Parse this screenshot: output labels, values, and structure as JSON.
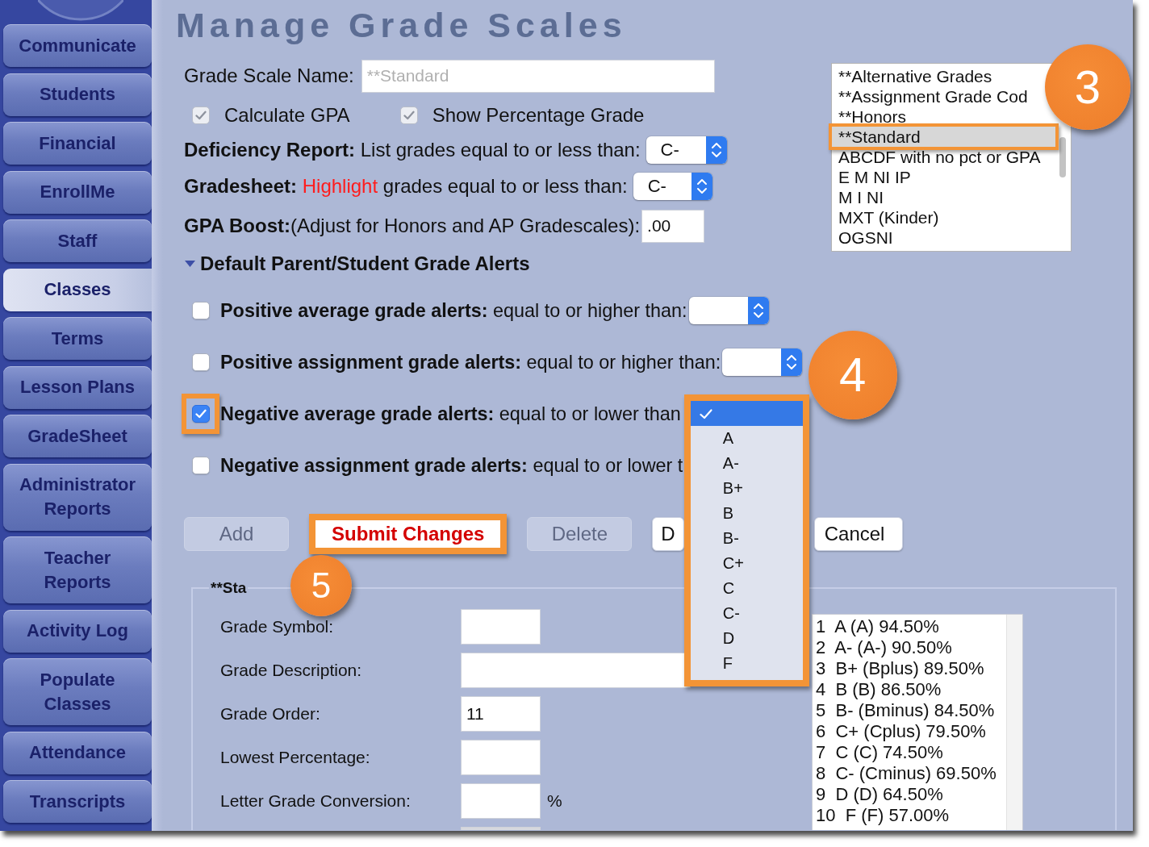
{
  "sidebar": {
    "items": [
      {
        "label": "Communicate",
        "selected": false
      },
      {
        "label": "Students",
        "selected": false
      },
      {
        "label": "Financial",
        "selected": false
      },
      {
        "label": "EnrollMe",
        "selected": false
      },
      {
        "label": "Staff",
        "selected": false
      },
      {
        "label": "Classes",
        "selected": true
      },
      {
        "label": "Terms",
        "selected": false
      },
      {
        "label": "Lesson Plans",
        "selected": false
      },
      {
        "label": "GradeSheet",
        "selected": false
      },
      {
        "label": "Administrator Reports",
        "selected": false
      },
      {
        "label": "Teacher Reports",
        "selected": false
      },
      {
        "label": "Activity Log",
        "selected": false
      },
      {
        "label": "Populate Classes",
        "selected": false
      },
      {
        "label": "Attendance",
        "selected": false
      },
      {
        "label": "Transcripts",
        "selected": false
      }
    ]
  },
  "page": {
    "title": "Manage Grade Scales"
  },
  "scale_form": {
    "name_field": {
      "label": "Grade Scale Name:",
      "placeholder": "**Standard"
    },
    "options": [
      {
        "label": "Calculate GPA",
        "checked": true,
        "disabled": true
      },
      {
        "label": "Show Percentage Grade",
        "checked": true,
        "disabled": true
      }
    ],
    "deficiency_report": {
      "text": "**Deficiency Report:** List grades equal to or less than:",
      "value": "C-"
    },
    "gradesheet": {
      "parts": [
        {
          "kind": "bold",
          "text": "Gradesheet:"
        },
        {
          "kind": "accent",
          "text": "Highlight"
        },
        {
          "kind": "plain",
          "text": "grades equal to or less than:"
        }
      ],
      "value": "C-"
    },
    "gpa_boost": {
      "text": "**GPA Boost:**(Adjust for Honors and AP Gradescales):",
      "value": ".00"
    }
  },
  "scale_list": {
    "items": [
      {
        "label": "**Alternative Grades",
        "selected": false,
        "highlighted": false
      },
      {
        "label": "**Assignment Grade Cod",
        "selected": false,
        "highlighted": false
      },
      {
        "label": "**Honors",
        "selected": false,
        "highlighted": false
      },
      {
        "label": "**Standard",
        "selected": true,
        "highlighted": true,
        "callout": "3"
      },
      {
        "label": "ABCDF with no pct or GPA",
        "selected": false,
        "highlighted": false
      },
      {
        "label": "E M NI IP",
        "selected": false,
        "highlighted": false
      },
      {
        "label": "M I NI",
        "selected": false,
        "highlighted": false
      },
      {
        "label": "MXT (Kinder)",
        "selected": false,
        "highlighted": false
      },
      {
        "label": "OGSNI",
        "selected": false,
        "highlighted": false
      }
    ]
  },
  "alerts": {
    "title": "Default Parent/Student Grade Alerts",
    "expanded": true,
    "rows": [
      {
        "text": "**Positive average grade alerts:** equal to or higher than:",
        "checked": false,
        "highlighted": false,
        "select": {
          "open": false
        }
      },
      {
        "text": "**Positive assignment grade alerts:** equal to or higher than:",
        "checked": false,
        "highlighted": false,
        "select": {
          "open": false
        }
      },
      {
        "text": "**Negative average grade alerts:** equal to or lower than",
        "checked": true,
        "highlighted": true,
        "select": {
          "open": true,
          "highlighted": true,
          "callout": "4",
          "options": [
            {
              "selected": true
            },
            {
              "label": "A",
              "selected": false
            },
            {
              "label": "A-",
              "selected": false
            },
            {
              "label": "B+",
              "selected": false
            },
            {
              "label": "B",
              "selected": false
            },
            {
              "label": "B-",
              "selected": false
            },
            {
              "label": "C+",
              "selected": false
            },
            {
              "label": "C",
              "selected": false
            },
            {
              "label": "C-",
              "selected": false
            },
            {
              "label": "D",
              "selected": false
            },
            {
              "label": "F",
              "selected": false
            }
          ]
        }
      },
      {
        "text": "**Negative assignment grade alerts:** equal to or lower t",
        "checked": false,
        "highlighted": false
      }
    ]
  },
  "buttons": [
    {
      "label": "Add",
      "kind": "plain",
      "disabled": true,
      "highlighted": false
    },
    {
      "label": "Submit Changes",
      "kind": "primary",
      "disabled": false,
      "highlighted": true,
      "callout": "5"
    },
    {
      "label": "Delete",
      "kind": "plain",
      "disabled": true,
      "highlighted": false
    },
    {
      "label": "D",
      "kind": "plain",
      "disabled": false,
      "highlighted": false
    },
    {
      "label": "Cancel",
      "kind": "plain",
      "disabled": false,
      "highlighted": false
    }
  ],
  "grade_entry": {
    "legend": "**Sta",
    "fields": [
      {
        "label": "Grade Symbol:",
        "kind": "short"
      },
      {
        "label": "Grade Description:",
        "kind": "wide"
      },
      {
        "label": "Grade Order:",
        "kind": "short",
        "value": "11"
      },
      {
        "label": "Lowest Percentage:",
        "kind": "short"
      },
      {
        "label": "Letter Grade Conversion:",
        "kind": "short",
        "unit": "%"
      },
      {
        "kind": "short",
        "disabled": true
      }
    ],
    "grades": [
      "1  A (A) 94.50%",
      "2  A- (A-) 90.50%",
      "3  B+ (Bplus) 89.50%",
      "4  B (B) 86.50%",
      "5  B- (Bminus) 84.50%",
      "6  C+ (Cplus) 79.50%",
      "7  C (C) 74.50%",
      "8  C- (Cminus) 69.50%",
      "9  D (D) 64.50%",
      "10  F (F) 57.00%"
    ]
  }
}
